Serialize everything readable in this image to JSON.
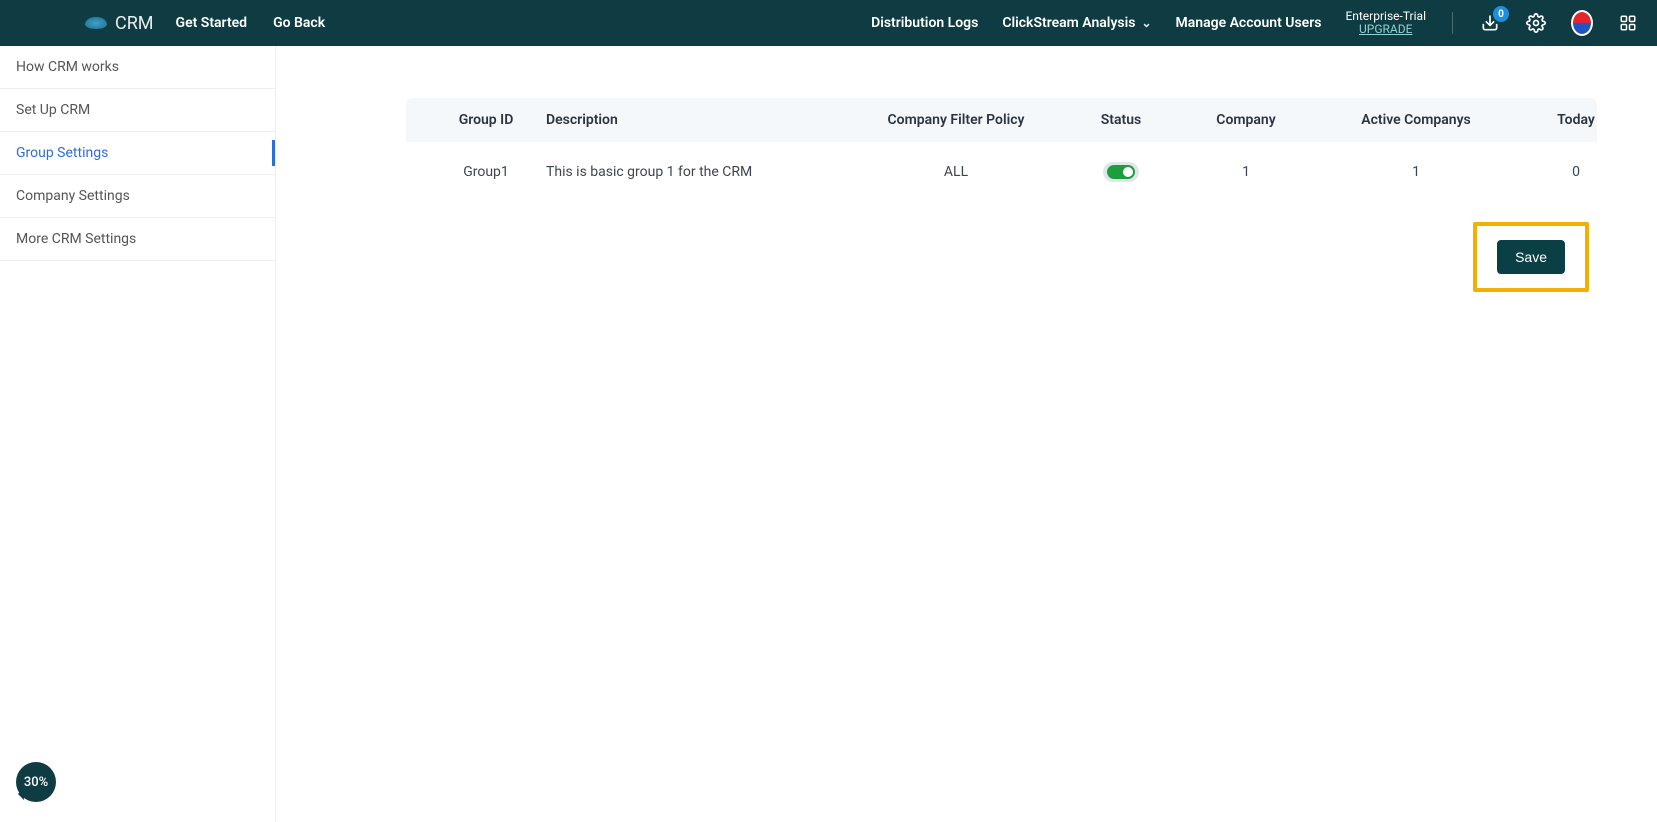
{
  "header": {
    "brand": "CRM",
    "links": [
      "Get Started",
      "Go Back"
    ],
    "right": {
      "distribution_logs": "Distribution Logs",
      "clickstream": "ClickStream Analysis",
      "manage_users": "Manage Account Users",
      "plan": "Enterprise-Trial",
      "upgrade": "UPGRADE",
      "inbox_badge": "0"
    }
  },
  "sidebar": {
    "items": [
      {
        "label": "How CRM works"
      },
      {
        "label": "Set Up CRM"
      },
      {
        "label": "Group Settings",
        "active": true
      },
      {
        "label": "Company Settings"
      },
      {
        "label": "More CRM Settings"
      }
    ]
  },
  "table": {
    "headers": {
      "group_id": "Group ID",
      "description": "Description",
      "filter_policy": "Company Filter Policy",
      "status": "Status",
      "company": "Company",
      "active_companys": "Active Companys",
      "today": "Today"
    },
    "rows": [
      {
        "group_id": "Group1",
        "description": "This is basic group 1 for the CRM",
        "filter_policy": "ALL",
        "status_on": true,
        "company": "1",
        "active_companys": "1",
        "today": "0"
      }
    ]
  },
  "actions": {
    "save": "Save"
  },
  "progress": "30%"
}
